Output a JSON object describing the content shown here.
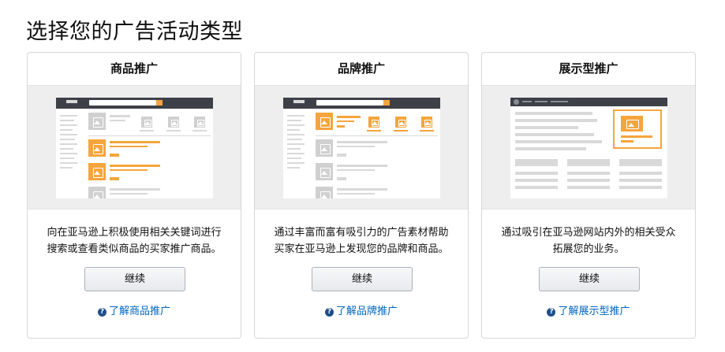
{
  "page": {
    "title": "选择您的广告活动类型"
  },
  "cards": [
    {
      "title": "商品推广",
      "description_line1": "向在亚马逊上积极使用相关关键词进行",
      "description_line2": "搜索或查看类似商品的买家推广商品。",
      "button_label": "继续",
      "link_label": "了解商品推广"
    },
    {
      "title": "品牌推广",
      "description_line1": "通过丰富而富有吸引力的广告素材帮助",
      "description_line2": "买家在亚马逊上发现您的品牌和商品。",
      "button_label": "继续",
      "link_label": "了解品牌推广"
    },
    {
      "title": "展示型推广",
      "description_line1": "通过吸引在亚马逊网站内外的相关受众",
      "description_line2": "拓展您的业务。",
      "button_label": "继续",
      "link_label": "了解展示型推广"
    }
  ],
  "icons": {
    "help": "question-circle-icon",
    "illustration_image": "image-placeholder-icon"
  },
  "colors": {
    "accent": "#f5a53c",
    "link": "#0066c0",
    "help_icon": "#1f4f8b",
    "mock_header": "#3e4048"
  }
}
